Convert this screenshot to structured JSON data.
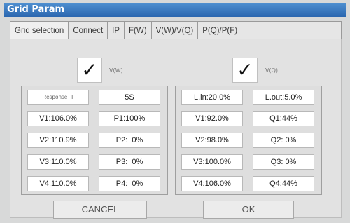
{
  "window": {
    "title": "Grid Param"
  },
  "tabs": [
    "Grid selection",
    "Connect",
    "IP",
    "F(W)",
    "V(W)/V(Q)",
    "P(Q)/P(F)"
  ],
  "left": {
    "checkbox": {
      "checked": true,
      "glyph": "✓",
      "label": "V(W)"
    },
    "response": {
      "label": "Response_T",
      "value": "5S"
    },
    "rows": [
      {
        "v": "V1:106.0%",
        "p": "P1:100%"
      },
      {
        "v": "V2:110.9%",
        "p": "P2:  0%"
      },
      {
        "v": "V3:110.0%",
        "p": "P3:  0%"
      },
      {
        "v": "V4:110.0%",
        "p": "P4:  0%"
      }
    ]
  },
  "right": {
    "checkbox": {
      "checked": true,
      "glyph": "✓",
      "label": "V(Q)"
    },
    "limits": {
      "lin": "L.in:20.0%",
      "lout": "L.out:5.0%"
    },
    "rows": [
      {
        "v": "V1:92.0%",
        "q": "Q1:44%"
      },
      {
        "v": "V2:98.0%",
        "q": "Q2: 0%"
      },
      {
        "v": "V3:100.0%",
        "q": "Q3: 0%"
      },
      {
        "v": "V4:106.0%",
        "q": "Q4:44%"
      }
    ]
  },
  "buttons": {
    "cancel": "CANCEL",
    "ok": "OK"
  }
}
